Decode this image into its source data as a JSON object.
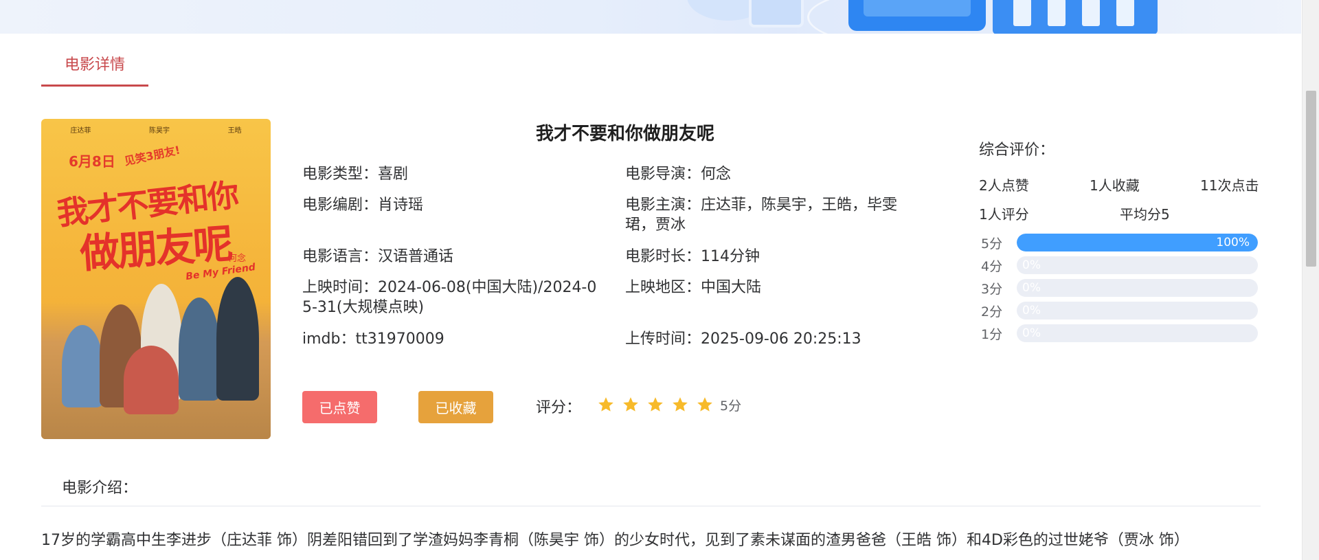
{
  "tab": {
    "label": "电影详情"
  },
  "poster": {
    "cast_top": [
      "庄达菲",
      "陈昊宇",
      "王皓"
    ],
    "date_text": "6月8日",
    "slogan": "见笑3朋友!",
    "title_line1": "我才不要和你",
    "title_line2": "做朋友呢",
    "english": "Be My Friend",
    "director_text": "何念"
  },
  "movie": {
    "title": "我才不要和你做朋友呢",
    "fields": {
      "type": {
        "label": "电影类型：",
        "value": "喜剧"
      },
      "director": {
        "label": "电影导演：",
        "value": "何念"
      },
      "writer": {
        "label": "电影编剧：",
        "value": "肖诗瑶"
      },
      "stars": {
        "label": "电影主演：",
        "value": "庄达菲，陈昊宇，王皓，毕雯珺，贾冰"
      },
      "language": {
        "label": "电影语言：",
        "value": "汉语普通话"
      },
      "duration": {
        "label": "电影时长：",
        "value": "114分钟"
      },
      "release": {
        "label": "上映时间：",
        "value": "2024-06-08(中国大陆)/2024-05-31(大规模点映)"
      },
      "region": {
        "label": "上映地区：",
        "value": "中国大陆"
      },
      "imdb": {
        "label": "imdb：",
        "value": "tt31970009"
      },
      "upload": {
        "label": "上传时间：",
        "value": "2025-09-06 20:25:13"
      }
    }
  },
  "actions": {
    "like_label": "已点赞",
    "fav_label": "已收藏",
    "rate_label": "评分：",
    "rating_stars": 5,
    "rating_text": "5分"
  },
  "panel": {
    "title": "综合评价：",
    "likes": "2人点赞",
    "favorites": "1人收藏",
    "clicks": "11次点击",
    "raters": "1人评分",
    "average": "平均分5",
    "distribution": [
      {
        "label": "5分",
        "percent": 100,
        "text": "100%"
      },
      {
        "label": "4分",
        "percent": 0,
        "text": "0%"
      },
      {
        "label": "3分",
        "percent": 0,
        "text": "0%"
      },
      {
        "label": "2分",
        "percent": 0,
        "text": "0%"
      },
      {
        "label": "1分",
        "percent": 0,
        "text": "0%"
      }
    ]
  },
  "intro": {
    "title": "电影介绍：",
    "text": "17岁的学霸高中生李进步（庄达菲 饰）阴差阳错回到了学渣妈妈李青桐（陈昊宇 饰）的少女时代，见到了素未谋面的渣男爸爸（王皓 饰）和4D彩色的过世姥爷（贾冰 饰）"
  },
  "colors": {
    "accent": "#c8494c",
    "like_button": "#f56c6c",
    "fav_button": "#e6a23c",
    "star": "#f7ba2a",
    "bar_fill": "#409eff",
    "bar_track": "#ebeef5"
  }
}
